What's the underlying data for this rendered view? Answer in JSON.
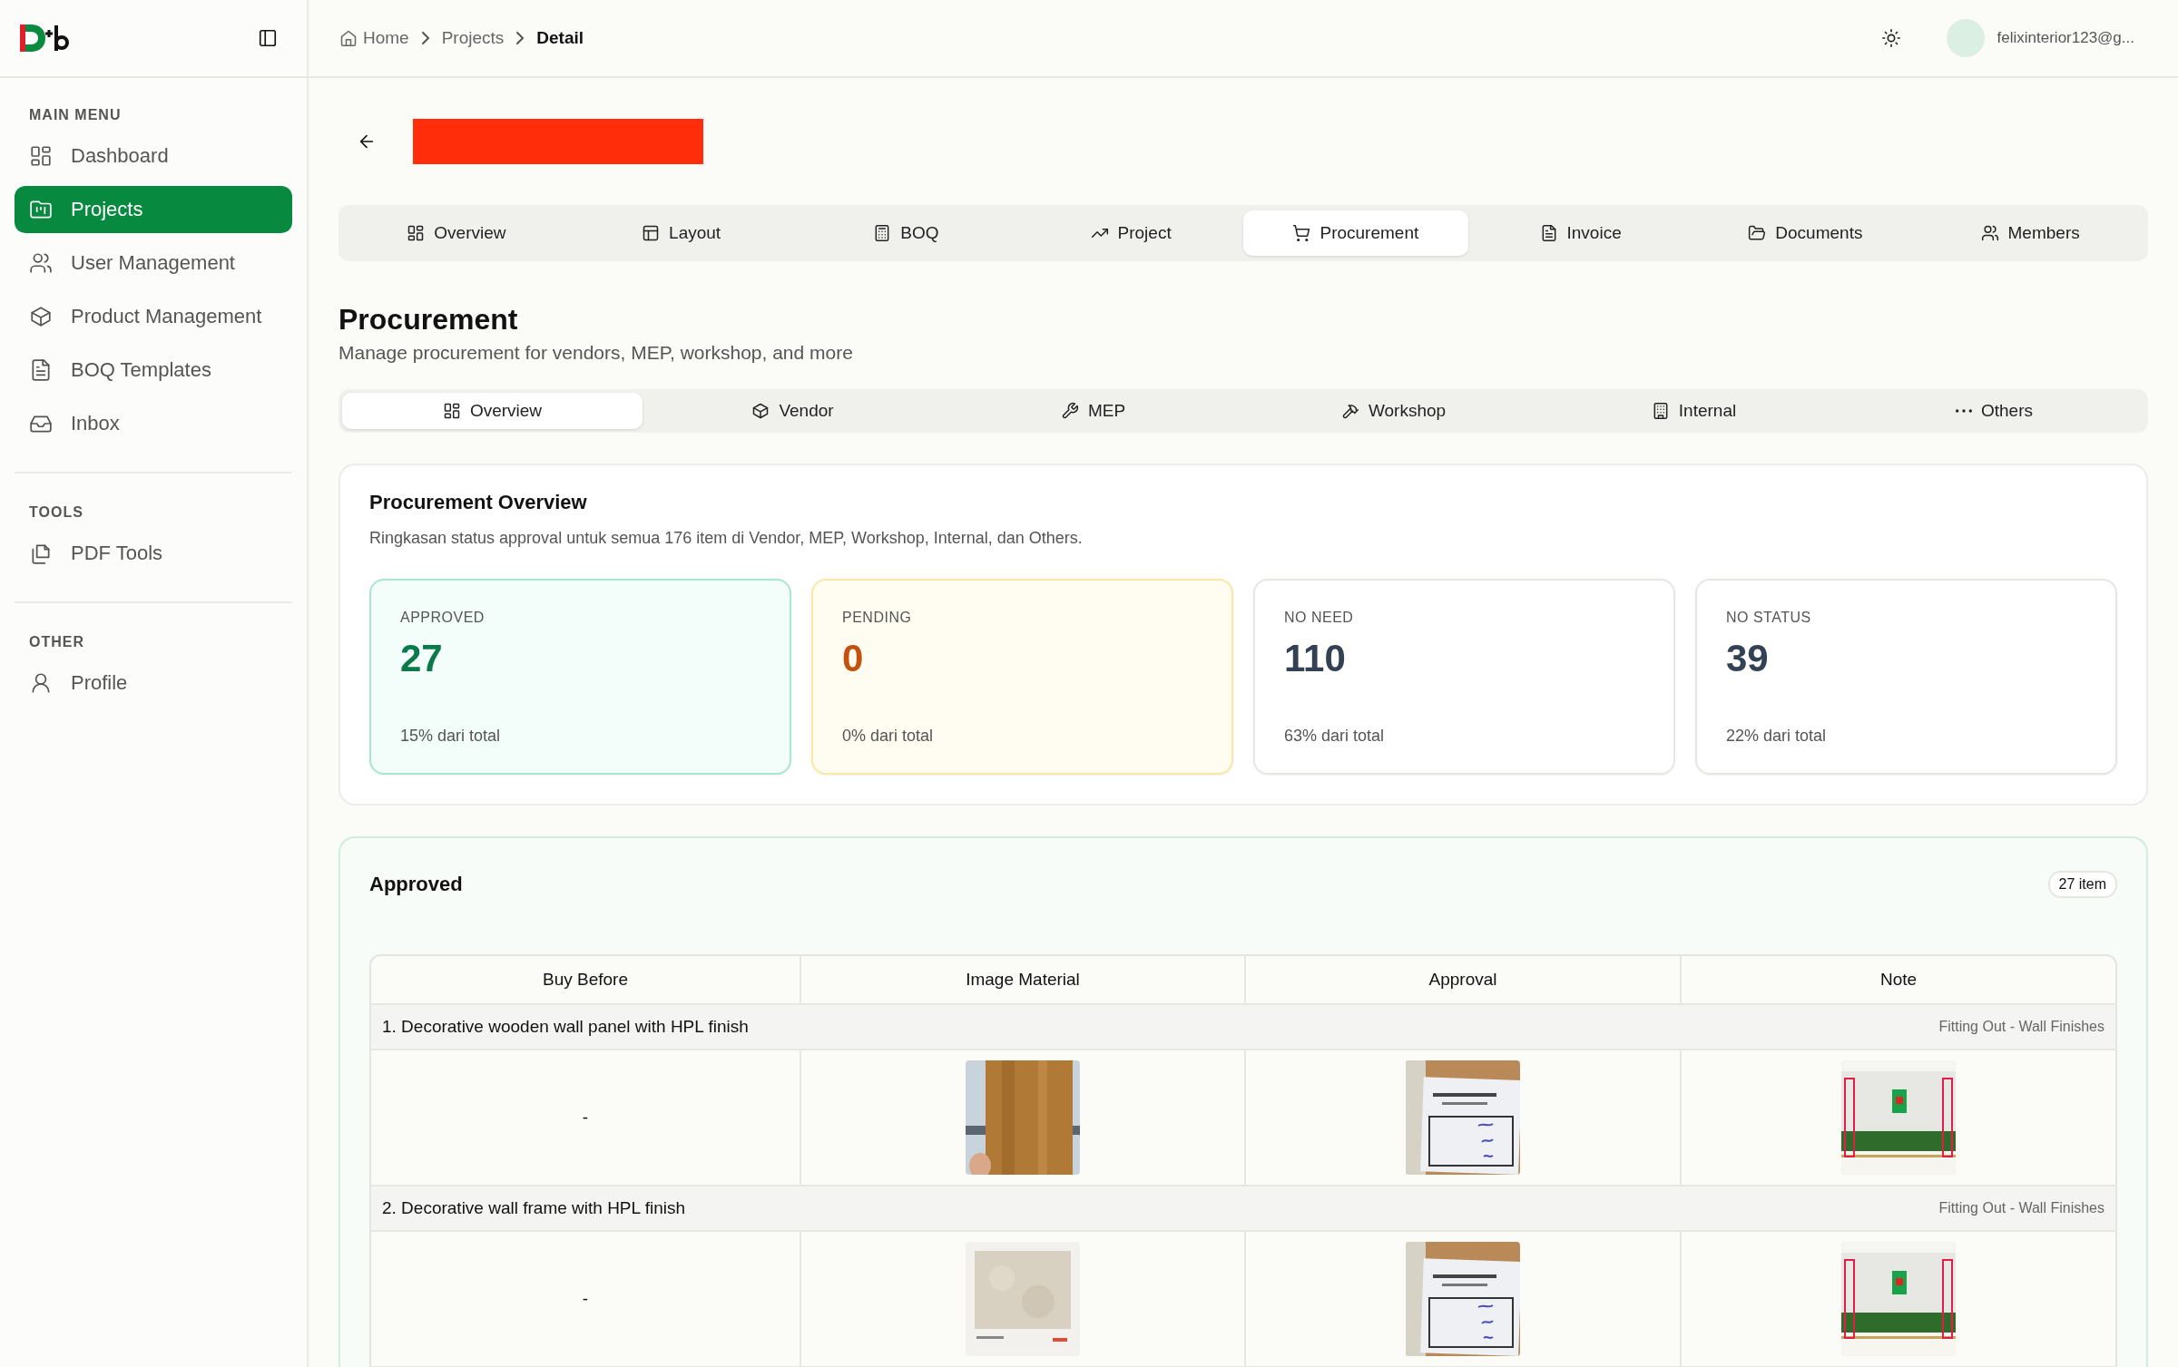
{
  "sidebar": {
    "sections": [
      {
        "title": "MAIN MENU",
        "items": [
          {
            "label": "Dashboard",
            "selected": false
          },
          {
            "label": "Projects",
            "selected": true
          },
          {
            "label": "User Management",
            "selected": false
          },
          {
            "label": "Product Management",
            "selected": false
          },
          {
            "label": "BOQ Templates",
            "selected": false
          },
          {
            "label": "Inbox",
            "selected": false
          }
        ]
      },
      {
        "title": "TOOLS",
        "items": [
          {
            "label": "PDF Tools",
            "selected": false
          }
        ]
      },
      {
        "title": "OTHER",
        "items": [
          {
            "label": "Profile",
            "selected": false
          }
        ]
      }
    ]
  },
  "breadcrumb": [
    "Home",
    "Projects",
    "Detail"
  ],
  "user": {
    "email": "felixinterior123@g..."
  },
  "tabs": [
    {
      "label": "Overview",
      "selected": false
    },
    {
      "label": "Layout",
      "selected": false
    },
    {
      "label": "BOQ",
      "selected": false
    },
    {
      "label": "Project",
      "selected": false
    },
    {
      "label": "Procurement",
      "selected": true
    },
    {
      "label": "Invoice",
      "selected": false
    },
    {
      "label": "Documents",
      "selected": false
    },
    {
      "label": "Members",
      "selected": false
    }
  ],
  "page": {
    "title": "Procurement",
    "subtitle": "Manage procurement for vendors, MEP, workshop, and more"
  },
  "subtabs": [
    {
      "label": "Overview",
      "selected": true
    },
    {
      "label": "Vendor",
      "selected": false
    },
    {
      "label": "MEP",
      "selected": false
    },
    {
      "label": "Workshop",
      "selected": false
    },
    {
      "label": "Internal",
      "selected": false
    },
    {
      "label": "Others",
      "selected": false
    }
  ],
  "overview": {
    "title": "Procurement Overview",
    "description": "Ringkasan status approval untuk semua 176 item di Vendor, MEP, Workshop, Internal, dan Others.",
    "stats": [
      {
        "label": "APPROVED",
        "value": "27",
        "note": "15% dari total",
        "kind": "success"
      },
      {
        "label": "PENDING",
        "value": "0",
        "note": "0% dari total",
        "kind": "warning"
      },
      {
        "label": "NO NEED",
        "value": "110",
        "note": "63% dari total",
        "kind": "neutral"
      },
      {
        "label": "NO STATUS",
        "value": "39",
        "note": "22% dari total",
        "kind": "neutral"
      }
    ]
  },
  "approved": {
    "title": "Approved",
    "count": "27 item",
    "columns": [
      "Buy Before",
      "Image Material",
      "Approval",
      "Note"
    ],
    "items": [
      {
        "name": "1. Decorative wooden wall panel with HPL finish",
        "category": "Fitting Out - Wall Finishes",
        "buy_before": "-"
      },
      {
        "name": "2. Decorative wall frame with HPL finish",
        "category": "Fitting Out - Wall Finishes",
        "buy_before": "-"
      }
    ]
  }
}
